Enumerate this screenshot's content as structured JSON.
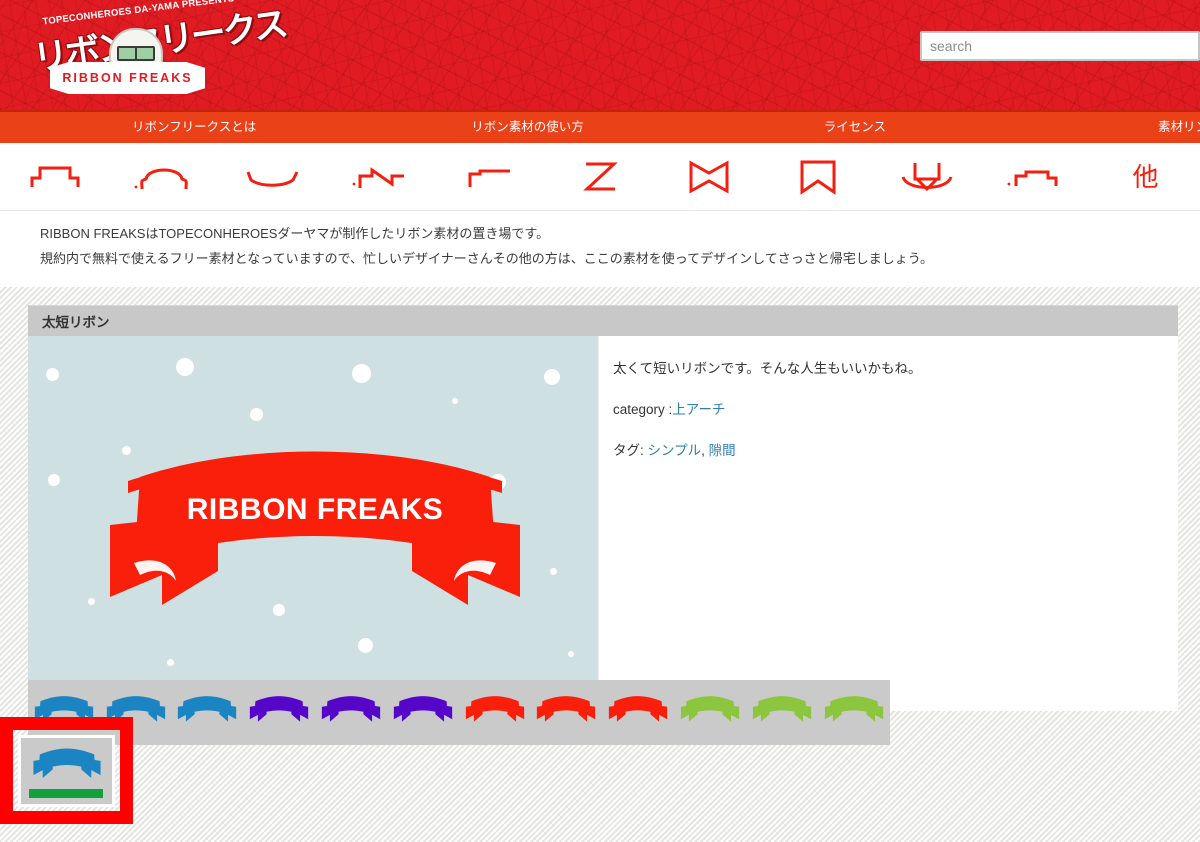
{
  "header": {
    "logo_tagline": "TOPECONHEROES DA-YAMA PRESENTS",
    "logo_kana": "リボンフリークス",
    "logo_ribbon_text": "RIBBON FREAKS"
  },
  "search": {
    "placeholder": "search",
    "value": ""
  },
  "nav": {
    "items": [
      {
        "label": "リボンフリークスとは"
      },
      {
        "label": "リボン素材の使い方"
      },
      {
        "label": "ライセンス"
      },
      {
        "label": "素材リンク"
      }
    ]
  },
  "category_icons": [
    {
      "name": "flat-top-ribbon-icon",
      "glyph": "flat"
    },
    {
      "name": "up-arch-ribbon-icon",
      "glyph": "arch"
    },
    {
      "name": "wave-ribbon-icon",
      "glyph": "wave"
    },
    {
      "name": "zigzag-ribbon-icon",
      "glyph": "zigzag"
    },
    {
      "name": "corner-ribbon-icon",
      "glyph": "corner"
    },
    {
      "name": "z-ribbon-icon",
      "glyph": "zed"
    },
    {
      "name": "bowtie-ribbon-icon",
      "glyph": "bowtie"
    },
    {
      "name": "banner-ribbon-icon",
      "glyph": "banner"
    },
    {
      "name": "down-arch-ribbon-icon",
      "glyph": "downarch"
    },
    {
      "name": "step-ribbon-icon",
      "glyph": "step"
    },
    {
      "name": "other-category-icon",
      "glyph": "other",
      "label": "他"
    }
  ],
  "intro": {
    "line1": "RIBBON FREAKSはTOPECONHEROESダーヤマが制作したリボン素材の置き場です。",
    "line2": "規約内で無料で使えるフリー素材となっていますので、忙しいデザイナーさんその他の方は、ここの素材を使ってデザインしてさっさと帰宅しましょう。"
  },
  "entry": {
    "title": "太短リボン",
    "preview_text": "RIBBON FREAKS",
    "description": "太くて短いリボンです。そんな人生もいいかもね。",
    "category_label": "category :",
    "category_value": "上アーチ",
    "tags_label": "タグ:",
    "tags": [
      "シンプル",
      "隙間"
    ],
    "tags_separator": ", "
  },
  "thumbnails": [
    {
      "color": "#1b84c2",
      "name": "thumb-blue-1"
    },
    {
      "color": "#1b84c2",
      "name": "thumb-blue-2"
    },
    {
      "color": "#1b84c2",
      "name": "thumb-blue-3"
    },
    {
      "color": "#5506c9",
      "name": "thumb-purple-1"
    },
    {
      "color": "#5506c9",
      "name": "thumb-purple-2"
    },
    {
      "color": "#5506c9",
      "name": "thumb-purple-3"
    },
    {
      "color": "#fa1f0a",
      "name": "thumb-red-1"
    },
    {
      "color": "#fa1f0a",
      "name": "thumb-red-2"
    },
    {
      "color": "#fa1f0a",
      "name": "thumb-red-3"
    },
    {
      "color": "#8cc63f",
      "name": "thumb-green-1"
    },
    {
      "color": "#8cc63f",
      "name": "thumb-green-2"
    },
    {
      "color": "#8cc63f",
      "name": "thumb-green-3"
    }
  ],
  "colors": {
    "brand_red": "#e01b22",
    "nav_red": "#eb4118",
    "icon_red": "#f41f10",
    "preview_bg": "#cfe0e3",
    "ribbon_red": "#fa1f0a",
    "link_blue": "#2f7db1",
    "strip_gray": "#cacaca",
    "header_gray": "#c8c8c8",
    "selection_red": "#ff0000",
    "progress_green": "#12a03c"
  }
}
